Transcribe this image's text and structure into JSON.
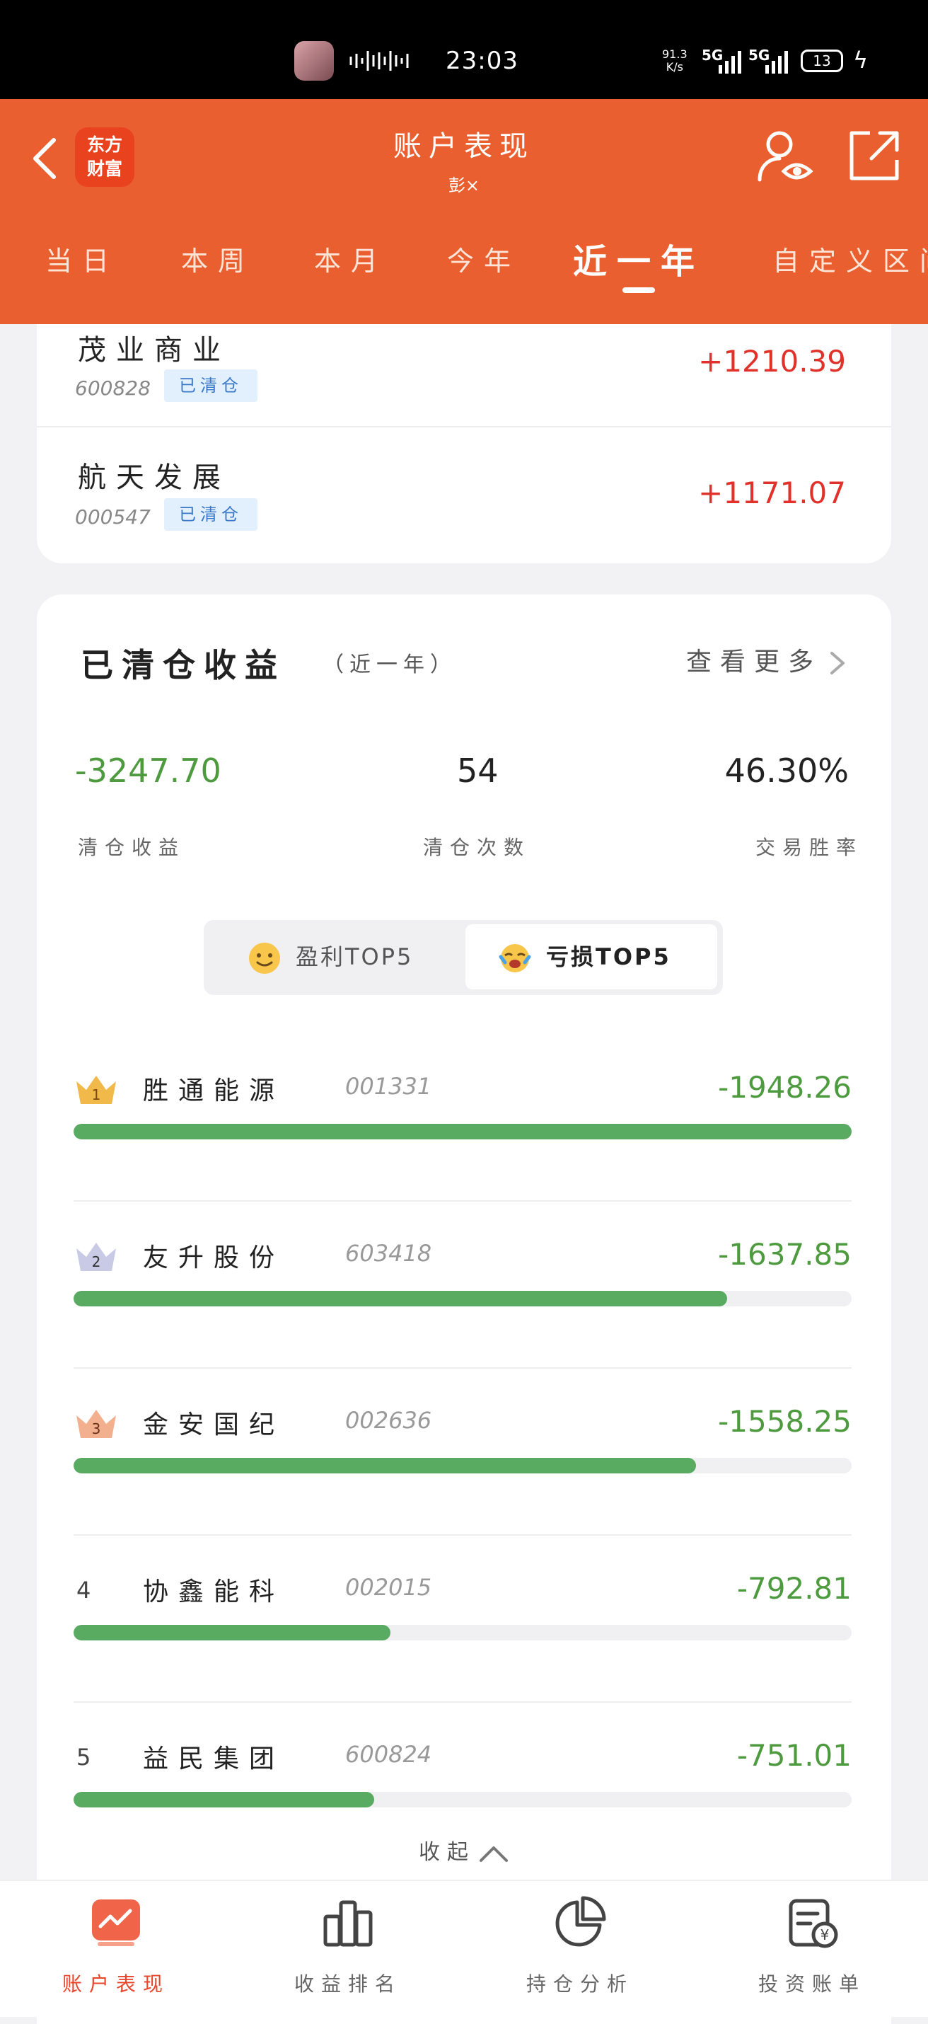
{
  "status_bar": {
    "time": "23:03",
    "net_speed_value": "91.3",
    "net_speed_unit": "K/s",
    "signal_1": "5G",
    "signal_2": "5G",
    "battery": "13"
  },
  "header": {
    "logo_line1": "东方",
    "logo_line2": "财富",
    "title": "账户表现",
    "subtitle": "彭×",
    "tabs": [
      {
        "label": "当日"
      },
      {
        "label": "本周"
      },
      {
        "label": "本月"
      },
      {
        "label": "今年"
      },
      {
        "label": "近一年",
        "active": true
      },
      {
        "label": "自定义区间"
      }
    ]
  },
  "top_list": [
    {
      "name": "茂业商业",
      "code": "600828",
      "badge": "已清仓",
      "profit": "+1210.39"
    },
    {
      "name": "航天发展",
      "code": "000547",
      "badge": "已清仓",
      "profit": "+1171.07"
    }
  ],
  "cleared": {
    "title": "已清仓收益",
    "period": "（近一年）",
    "more": "查看更多",
    "stats": [
      {
        "value": "-3247.70",
        "label": "清仓收益"
      },
      {
        "value": "54",
        "label": "清仓次数"
      },
      {
        "value": "46.30%",
        "label": "交易胜率"
      }
    ],
    "segment": {
      "profit_tab": "盈利TOP5",
      "loss_tab": "亏损TOP5",
      "selected": "loss_tab"
    },
    "ranking": [
      {
        "rank": "1",
        "name": "胜通能源",
        "code": "001331",
        "value": "-1948.26",
        "share": 1.0
      },
      {
        "rank": "2",
        "name": "友升股份",
        "code": "603418",
        "value": "-1637.85",
        "share": 0.84
      },
      {
        "rank": "3",
        "name": "金安国纪",
        "code": "002636",
        "value": "-1558.25",
        "share": 0.8
      },
      {
        "rank": "4",
        "name": "协鑫能科",
        "code": "002015",
        "value": "-792.81",
        "share": 0.407
      },
      {
        "rank": "5",
        "name": "益民集团",
        "code": "600824",
        "value": "-751.01",
        "share": 0.386
      }
    ],
    "collapse": "收起"
  },
  "colors": {
    "brand": "#ea5f2f",
    "profit": "#e0322a",
    "loss": "#4e9b3f",
    "bar": "#5aab62"
  },
  "bottom_nav": [
    {
      "label": "账户表现",
      "icon": "chart-icon",
      "active": true
    },
    {
      "label": "收益排名",
      "icon": "bar-chart-icon"
    },
    {
      "label": "持仓分析",
      "icon": "pie-chart-icon"
    },
    {
      "label": "投资账单",
      "icon": "bill-icon"
    }
  ]
}
